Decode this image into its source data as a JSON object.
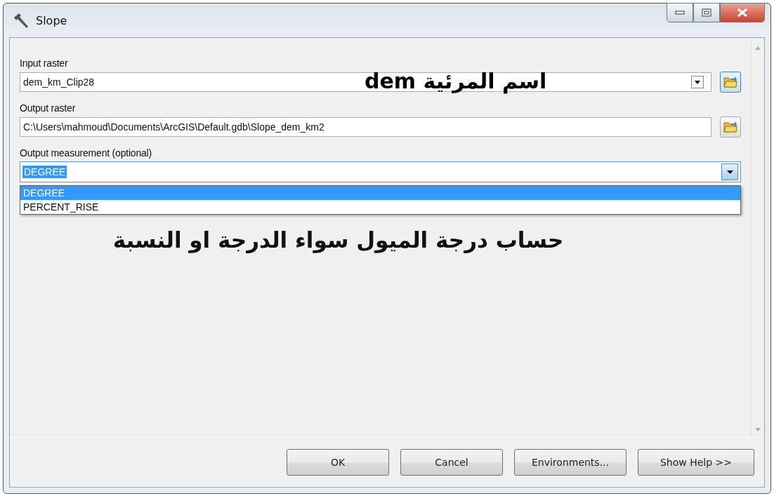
{
  "window": {
    "title": "Slope"
  },
  "fields": [
    {
      "label": "Input raster",
      "value": "dem_km_Clip28",
      "kind": "combo"
    },
    {
      "label": "Output raster",
      "value": "C:\\Users\\mahmoud\\Documents\\ArcGIS\\Default.gdb\\Slope_dem_km2",
      "kind": "text"
    }
  ],
  "measurement": {
    "label": "Output measurement (optional)",
    "value": "DEGREE",
    "expanded": true,
    "options": [
      {
        "label": "DEGREE",
        "selected": true
      },
      {
        "label": "PERCENT_RISE",
        "selected": false
      }
    ]
  },
  "annotations": [
    {
      "text": "اسم المرئية dem"
    },
    {
      "text": "حساب درجة الميول سواء الدرجة او النسبة"
    }
  ],
  "buttons": [
    "OK",
    "Cancel",
    "Environments...",
    "Show Help >>"
  ]
}
